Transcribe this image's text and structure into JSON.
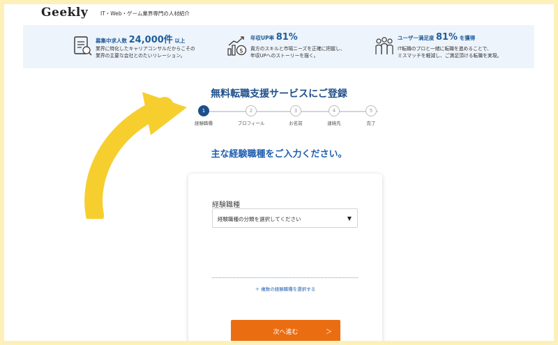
{
  "header": {
    "logo": "Geekly",
    "tagline": "IT・Web・ゲーム業界専門の人材紹介"
  },
  "stats": [
    {
      "icon": "document-list-icon",
      "head_prefix": "募集中求人数 ",
      "head_big": "24,000件",
      "head_suffix": " 以上",
      "desc1": "業界に特化したキャリアコンサルだからこその",
      "desc2": "業界の主要な会社とのたいリレーション。"
    },
    {
      "icon": "money-growth-icon",
      "head_prefix": "年収UP率 ",
      "head_big": "81%",
      "head_suffix": "",
      "desc1": "貴方のスキルと市場ニーズを正確に把握し、",
      "desc2": "年収UPへのストーリーを描く。"
    },
    {
      "icon": "users-group-icon",
      "head_prefix": "ユーザー満足度 ",
      "head_big": "81%",
      "head_suffix": " を獲得",
      "desc1": "IT転職のプロと一緒に転職を進めることで、",
      "desc2": "ミスマッチを軽減し、ご満足頂ける転職を実現。"
    }
  ],
  "form": {
    "title": "無料転職支援サービスにご登録",
    "steps": [
      {
        "num": "1",
        "label": "経験職種"
      },
      {
        "num": "2",
        "label": "プロフィール"
      },
      {
        "num": "3",
        "label": "お名前"
      },
      {
        "num": "4",
        "label": "連絡先"
      },
      {
        "num": "5",
        "label": "完了"
      }
    ],
    "active_step": 1,
    "question": "主な経験職種をご入力ください。",
    "field_label": "経験職種",
    "select_value": "経験職種の分類を選択してください",
    "add_link": "＋ 複数の経験職種を選択する",
    "next_label": "次へ進む",
    "next_chevron": "＞"
  },
  "colors": {
    "accent": "#1f4f8a",
    "button": "#eb6d12",
    "arrow": "#f6cf2f",
    "frame": "#fdf0b8"
  }
}
